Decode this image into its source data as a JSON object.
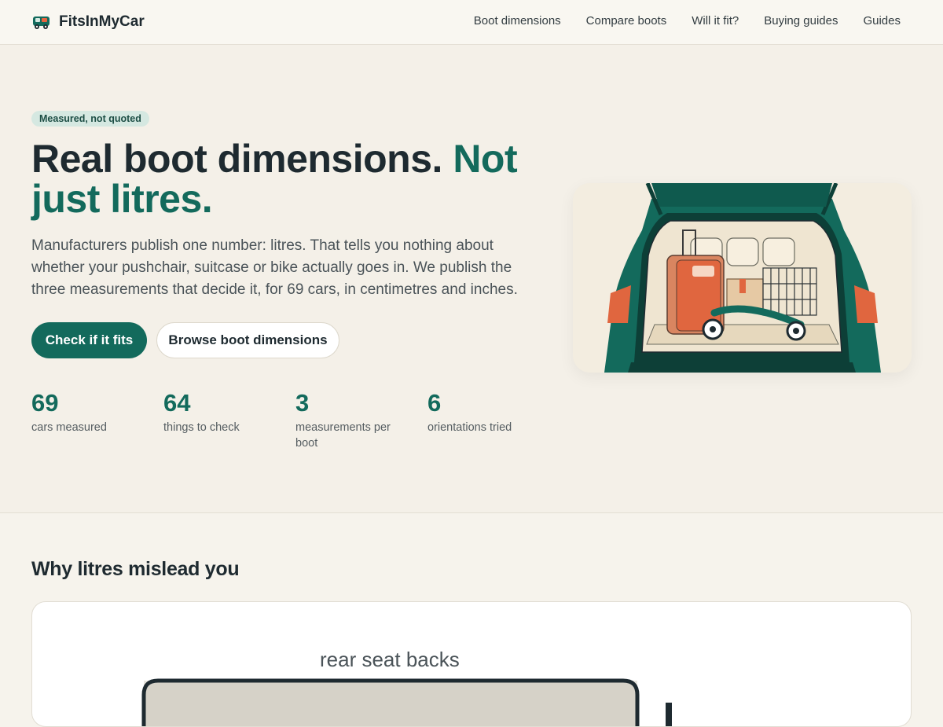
{
  "header": {
    "brand": "FitsInMyCar",
    "nav": [
      "Boot dimensions",
      "Compare boots",
      "Will it fit?",
      "Buying guides",
      "Guides"
    ]
  },
  "hero": {
    "badge": "Measured, not quoted",
    "title_main": "Real boot dimensions.",
    "title_accent": "Not just litres.",
    "description": "Manufacturers publish one number: litres. That tells you nothing about whether your pushchair, suitcase or bike actually goes in. We publish the three measurements that decide it, for 69 cars, in centimetres and inches.",
    "primary_cta": "Check if it fits",
    "secondary_cta": "Browse boot dimensions",
    "stats": [
      {
        "value": "69",
        "label": "cars measured"
      },
      {
        "value": "64",
        "label": "things to check"
      },
      {
        "value": "3",
        "label": "measurements per boot"
      },
      {
        "value": "6",
        "label": "orientations tried"
      }
    ]
  },
  "section": {
    "title": "Why litres mislead you",
    "diagram_label": "rear seat backs"
  },
  "colors": {
    "accent": "#136a5c",
    "background": "#f4f0e8",
    "text": "#1e2a30"
  }
}
